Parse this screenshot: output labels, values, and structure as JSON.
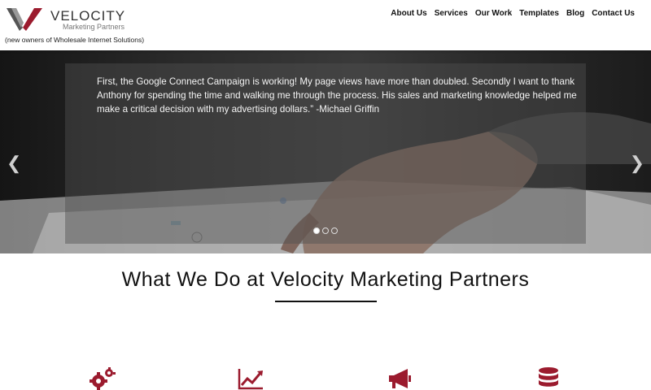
{
  "header": {
    "brand": "VELOCITY",
    "tagline": "Marketing Partners",
    "owners_note": "(new owners of Wholesale Internet Solutions)"
  },
  "nav": {
    "items": [
      {
        "label": "About Us"
      },
      {
        "label": "Services"
      },
      {
        "label": "Our Work"
      },
      {
        "label": "Templates"
      },
      {
        "label": "Blog"
      },
      {
        "label": "Contact Us"
      }
    ]
  },
  "hero": {
    "quote": "First, the Google Connect Campaign is working! My page views have more than doubled. Secondly I want to thank Anthony for spending the time and walking me through the process. His sales and marketing knowledge helped me make a critical decision with my advertising dollars.” -Michael Griffin",
    "prev_glyph": "❮",
    "next_glyph": "❯",
    "active_slide": 1,
    "slide_count": 3
  },
  "section": {
    "title": "What We Do at Velocity Marketing Partners"
  },
  "features": {
    "icons": [
      "gears-icon",
      "line-chart-icon",
      "megaphone-icon",
      "database-icon"
    ],
    "accent_color": "#9b1b2e"
  },
  "colors": {
    "brand_red": "#9b1b2e",
    "nav_text": "#111111"
  }
}
